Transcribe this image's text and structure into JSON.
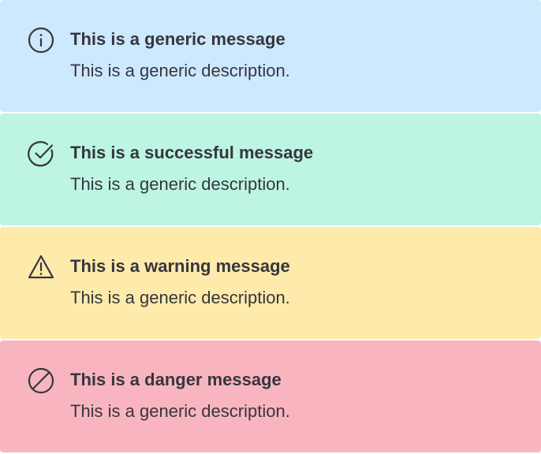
{
  "alerts": [
    {
      "variant": "info",
      "icon": "info-circle-icon",
      "title": "This is a generic message",
      "description": "This is a generic description.",
      "background": "#cde9fe"
    },
    {
      "variant": "success",
      "icon": "check-circle-icon",
      "title": "This is a successful message",
      "description": "This is a generic description.",
      "background": "#bdf5e2"
    },
    {
      "variant": "warning",
      "icon": "warning-triangle-icon",
      "title": "This is a warning message",
      "description": "This is a generic description.",
      "background": "#feeaaa"
    },
    {
      "variant": "danger",
      "icon": "prohibited-circle-icon",
      "title": "This is a danger message",
      "description": "This is a generic description.",
      "background": "#f9b5bf"
    }
  ],
  "colors": {
    "text": "#36363f"
  }
}
